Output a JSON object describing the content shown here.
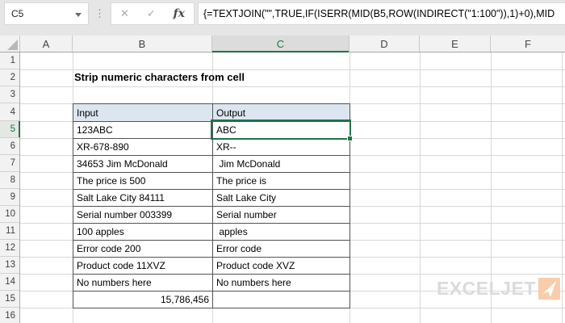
{
  "formula_bar": {
    "name_box_value": "C5",
    "cancel_icon": "✕",
    "enter_icon": "✓",
    "insert_function_label": "fx",
    "formula": "{=TEXTJOIN(\"\",TRUE,IF(ISERR(MID(B5,ROW(INDIRECT(\"1:100\")),1)+0),MID"
  },
  "sheet": {
    "title": "Strip numeric characters from cell",
    "selected_cell": "C5",
    "column_headers": [
      "A",
      "B",
      "C",
      "D",
      "E",
      "F"
    ],
    "row_headers": [
      "1",
      "2",
      "3",
      "4",
      "5",
      "6",
      "7",
      "8",
      "9",
      "10",
      "11",
      "12",
      "13",
      "14",
      "15",
      "16"
    ],
    "table": {
      "headers": {
        "input": "Input",
        "output": "Output"
      },
      "rows": [
        {
          "input": "123ABC",
          "output": "ABC"
        },
        {
          "input": "XR-678-890",
          "output": "XR--"
        },
        {
          "input": "34653 Jim McDonald",
          "output": " Jim McDonald"
        },
        {
          "input": "The price is 500",
          "output": "The price is"
        },
        {
          "input": "Salt Lake City 84111",
          "output": "Salt Lake City"
        },
        {
          "input": "Serial number 003399",
          "output": "Serial number"
        },
        {
          "input": "100 apples",
          "output": " apples"
        },
        {
          "input": "Error code 200",
          "output": "Error code"
        },
        {
          "input": "Product code 11XVZ",
          "output": "Product code XVZ"
        },
        {
          "input": "No numbers here",
          "output": "No numbers here"
        },
        {
          "input": "15,786,456",
          "output": ""
        }
      ]
    }
  },
  "logo": {
    "text": "EXCELJET"
  },
  "colors": {
    "accent_green": "#217346",
    "table_header_fill": "#DCE6F1",
    "logo_orange": "#F9CDA9",
    "logo_gray": "#DBDBDB",
    "chrome_gray": "#E6E6E6"
  }
}
